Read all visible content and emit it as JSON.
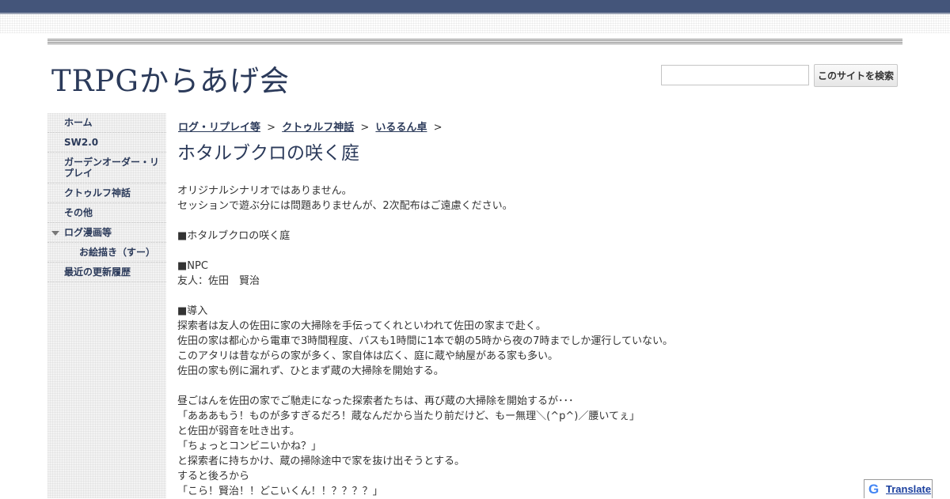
{
  "site": {
    "title": "TRPGからあげ会"
  },
  "search": {
    "placeholder": "",
    "button_label": "このサイトを検索"
  },
  "sidebar": {
    "items": [
      {
        "label": "ホーム"
      },
      {
        "label": "SW2.0"
      },
      {
        "label": "ガーデンオーダー・リプレイ"
      },
      {
        "label": "クトゥルフ神話"
      },
      {
        "label": "その他"
      },
      {
        "label": "ログ漫画等",
        "expanded": true
      },
      {
        "label": "お絵描き（すー）",
        "sub": true
      },
      {
        "label": "最近の更新履歴"
      }
    ]
  },
  "breadcrumb": {
    "items": [
      {
        "label": "ログ・リプレイ等"
      },
      {
        "label": "クトゥルフ神話"
      },
      {
        "label": "いるるん卓"
      }
    ],
    "separator": ">"
  },
  "page": {
    "title": "ホタルブクロの咲く庭",
    "lines": [
      "オリジナルシナリオではありません。",
      "セッションで遊ぶ分には問題ありませんが、2次配布はご遠慮ください。",
      "",
      "■ホタルブクロの咲く庭",
      "",
      "■NPC",
      "友人：佐田　賢治",
      "",
      "■導入",
      "探索者は友人の佐田に家の大掃除を手伝ってくれといわれて佐田の家まで赴く。",
      "佐田の家は都心から電車で3時間程度、バスも1時間に1本で朝の5時から夜の7時までしか運行していない。",
      "このアタリは昔ながらの家が多く、家自体は広く、庭に蔵や納屋がある家も多い。",
      "佐田の家も例に漏れず、ひとまず蔵の大掃除を開始する。",
      "",
      "昼ごはんを佐田の家でご馳走になった探索者たちは、再び蔵の大掃除を開始するが･･･",
      "「あああもう！ものが多すぎるだろ！蔵なんだから当たり前だけど、もー無理＼(^p^)／腰いてぇ」",
      "と佐田が弱音を吐き出す。",
      "「ちょっとコンビニいかね？」",
      "と探索者に持ちかけ、蔵の掃除途中で家を抜け出そうとする。",
      "すると後ろから",
      "「こら！賢治！！どこいくん！！？？？？」"
    ]
  },
  "translate": {
    "label": "Translate",
    "logo": "G"
  }
}
